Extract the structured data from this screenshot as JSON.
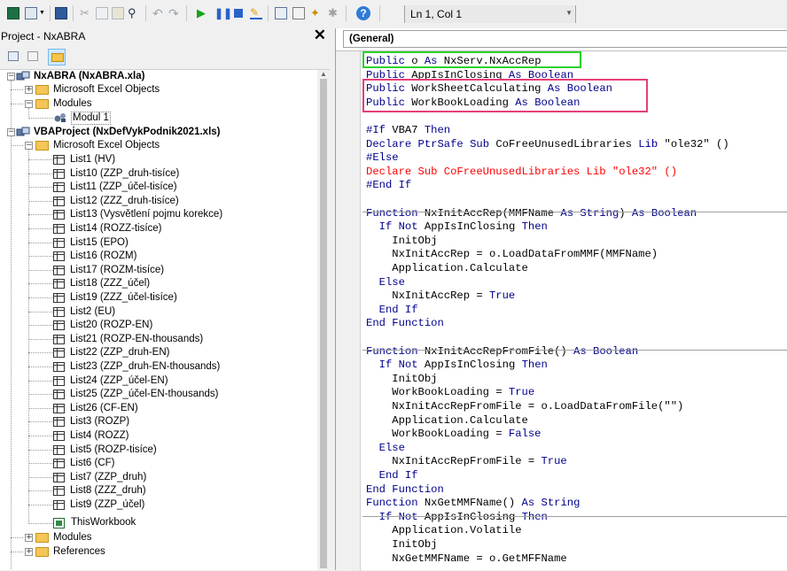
{
  "toolbar": {
    "status": "Ln 1, Col 1",
    "icons": [
      "excel-view-icon",
      "insert-userform-icon",
      "save-icon",
      "cut-icon",
      "copy-icon",
      "paste-icon",
      "find-icon",
      "undo-icon",
      "redo-icon",
      "run-icon",
      "break-icon",
      "reset-icon",
      "design-mode-icon",
      "project-explorer-icon",
      "properties-window-icon",
      "object-browser-icon",
      "toolbox-icon",
      "help-icon"
    ]
  },
  "project_panel": {
    "title": "Project - NxABRA",
    "close": "✕",
    "tree": {
      "nxabra": {
        "label": "NxABRA (NxABRA.xla)"
      },
      "nxabra_excel": {
        "label": "Microsoft Excel Objects"
      },
      "nxabra_modules": {
        "label": "Modules"
      },
      "modul1": {
        "label": "Modul 1"
      },
      "vbaproject": {
        "label": "VBAProject (NxDefVykPodnik2021.xls)"
      },
      "vba_excel": {
        "label": "Microsoft Excel Objects"
      },
      "sheets": [
        "List1 (HV)",
        "List10 (ZZP_druh-tisíce)",
        "List11 (ZZP_účel-tisíce)",
        "List12 (ZZZ_druh-tisíce)",
        "List13 (Vysvětlení pojmu korekce)",
        "List14 (ROZZ-tisíce)",
        "List15 (EPO)",
        "List16 (ROZM)",
        "List17 (ROZM-tisíce)",
        "List18 (ZZZ_účel)",
        "List19 (ZZZ_účel-tisíce)",
        "List2 (EU)",
        "List20 (ROZP-EN)",
        "List21 (ROZP-EN-thousands)",
        "List22 (ZZP_druh-EN)",
        "List23 (ZZP_druh-EN-thousands)",
        "List24 (ZZP_účel-EN)",
        "List25 (ZZP_účel-EN-thousands)",
        "List26 (CF-EN)",
        "List3 (ROZP)",
        "List4 (ROZZ)",
        "List5 (ROZP-tisíce)",
        "List6 (CF)",
        "List7 (ZZP_druh)",
        "List8 (ZZZ_druh)",
        "List9 (ZZP_účel)"
      ],
      "thisworkbook": {
        "label": "ThisWorkbook"
      },
      "vba_modules": {
        "label": "Modules"
      },
      "vba_references": {
        "label": "References"
      }
    }
  },
  "code_panel": {
    "object_combo": "(General)",
    "lines": [
      {
        "segs": [
          {
            "t": "Public",
            "k": 1
          },
          {
            "t": " o "
          },
          {
            "t": "As",
            "k": 1
          },
          {
            "t": " NxServ.NxAccRep"
          }
        ]
      },
      {
        "segs": [
          {
            "t": "Public",
            "k": 1
          },
          {
            "t": " AppIsInClosing "
          },
          {
            "t": "As",
            "k": 1
          },
          {
            "t": " "
          },
          {
            "t": "Boolean",
            "k": 1
          }
        ]
      },
      {
        "segs": [
          {
            "t": "Public",
            "k": 1
          },
          {
            "t": " WorkSheetCalculating "
          },
          {
            "t": "As",
            "k": 1
          },
          {
            "t": " "
          },
          {
            "t": "Boolean",
            "k": 1
          }
        ]
      },
      {
        "segs": [
          {
            "t": "Public",
            "k": 1
          },
          {
            "t": " WorkBookLoading "
          },
          {
            "t": "As",
            "k": 1
          },
          {
            "t": " "
          },
          {
            "t": "Boolean",
            "k": 1
          }
        ]
      },
      {
        "segs": []
      },
      {
        "segs": [
          {
            "t": "#If",
            "k": 1
          },
          {
            "t": " VBA7 "
          },
          {
            "t": "Then",
            "k": 1
          }
        ]
      },
      {
        "segs": [
          {
            "t": "Declare",
            "k": 1
          },
          {
            "t": " "
          },
          {
            "t": "PtrSafe",
            "k": 1
          },
          {
            "t": " "
          },
          {
            "t": "Sub",
            "k": 1
          },
          {
            "t": " CoFreeUnusedLibraries "
          },
          {
            "t": "Lib",
            "k": 1
          },
          {
            "t": " \"ole32\" ()"
          }
        ]
      },
      {
        "segs": [
          {
            "t": "#Else",
            "k": 1
          }
        ]
      },
      {
        "segs": [
          {
            "t": "Declare Sub CoFreeUnusedLibraries Lib \"ole32\" ()",
            "r": 1
          }
        ]
      },
      {
        "segs": [
          {
            "t": "#End If",
            "k": 1
          }
        ]
      },
      {
        "segs": []
      },
      {
        "segs": [
          {
            "t": "Function",
            "k": 1
          },
          {
            "t": " NxInitAccRep(MMFName "
          },
          {
            "t": "As",
            "k": 1
          },
          {
            "t": " "
          },
          {
            "t": "String",
            "k": 1
          },
          {
            "t": ") "
          },
          {
            "t": "As",
            "k": 1
          },
          {
            "t": " "
          },
          {
            "t": "Boolean",
            "k": 1
          }
        ]
      },
      {
        "segs": [
          {
            "t": "  "
          },
          {
            "t": "If",
            "k": 1
          },
          {
            "t": " "
          },
          {
            "t": "Not",
            "k": 1
          },
          {
            "t": " AppIsInClosing "
          },
          {
            "t": "Then",
            "k": 1
          }
        ]
      },
      {
        "segs": [
          {
            "t": "    InitObj"
          }
        ]
      },
      {
        "segs": [
          {
            "t": "    NxInitAccRep = o.LoadDataFromMMF(MMFName)"
          }
        ]
      },
      {
        "segs": [
          {
            "t": "    Application.Calculate"
          }
        ]
      },
      {
        "segs": [
          {
            "t": "  "
          },
          {
            "t": "Else",
            "k": 1
          }
        ]
      },
      {
        "segs": [
          {
            "t": "    NxInitAccRep = "
          },
          {
            "t": "True",
            "k": 1
          }
        ]
      },
      {
        "segs": [
          {
            "t": "  "
          },
          {
            "t": "End If",
            "k": 1
          }
        ]
      },
      {
        "segs": [
          {
            "t": "End Function",
            "k": 1
          }
        ]
      },
      {
        "segs": []
      },
      {
        "segs": [
          {
            "t": "Function",
            "k": 1
          },
          {
            "t": " NxInitAccRepFromFile() "
          },
          {
            "t": "As",
            "k": 1
          },
          {
            "t": " "
          },
          {
            "t": "Boolean",
            "k": 1
          }
        ]
      },
      {
        "segs": [
          {
            "t": "  "
          },
          {
            "t": "If",
            "k": 1
          },
          {
            "t": " "
          },
          {
            "t": "Not",
            "k": 1
          },
          {
            "t": " AppIsInClosing "
          },
          {
            "t": "Then",
            "k": 1
          }
        ]
      },
      {
        "segs": [
          {
            "t": "    InitObj"
          }
        ]
      },
      {
        "segs": [
          {
            "t": "    WorkBookLoading = "
          },
          {
            "t": "True",
            "k": 1
          }
        ]
      },
      {
        "segs": [
          {
            "t": "    NxInitAccRepFromFile = o.LoadDataFromFile(\"\")"
          }
        ]
      },
      {
        "segs": [
          {
            "t": "    Application.Calculate"
          }
        ]
      },
      {
        "segs": [
          {
            "t": "    WorkBookLoading = "
          },
          {
            "t": "False",
            "k": 1
          }
        ]
      },
      {
        "segs": [
          {
            "t": "  "
          },
          {
            "t": "Else",
            "k": 1
          }
        ]
      },
      {
        "segs": [
          {
            "t": "    NxInitAccRepFromFile = "
          },
          {
            "t": "True",
            "k": 1
          }
        ]
      },
      {
        "segs": [
          {
            "t": "  "
          },
          {
            "t": "End If",
            "k": 1
          }
        ]
      },
      {
        "segs": [
          {
            "t": "End Function",
            "k": 1
          }
        ]
      },
      {
        "segs": [
          {
            "t": "Function",
            "k": 1
          },
          {
            "t": " NxGetMMFName() "
          },
          {
            "t": "As",
            "k": 1
          },
          {
            "t": " "
          },
          {
            "t": "String",
            "k": 1
          }
        ]
      },
      {
        "segs": [
          {
            "t": "  "
          },
          {
            "t": "If",
            "k": 1
          },
          {
            "t": " "
          },
          {
            "t": "Not",
            "k": 1
          },
          {
            "t": " AppIsInClosing "
          },
          {
            "t": "Then",
            "k": 1
          }
        ]
      },
      {
        "segs": [
          {
            "t": "    Application.Volatile"
          }
        ]
      },
      {
        "segs": [
          {
            "t": "    InitObj"
          }
        ]
      },
      {
        "segs": [
          {
            "t": "    NxGetMMFName = o.GetMFFName"
          }
        ]
      }
    ]
  },
  "colors": {
    "keyword": "#00008b",
    "error": "#ff0000",
    "highlight_green": "#2bd12b",
    "highlight_pink": "#e53f77"
  }
}
